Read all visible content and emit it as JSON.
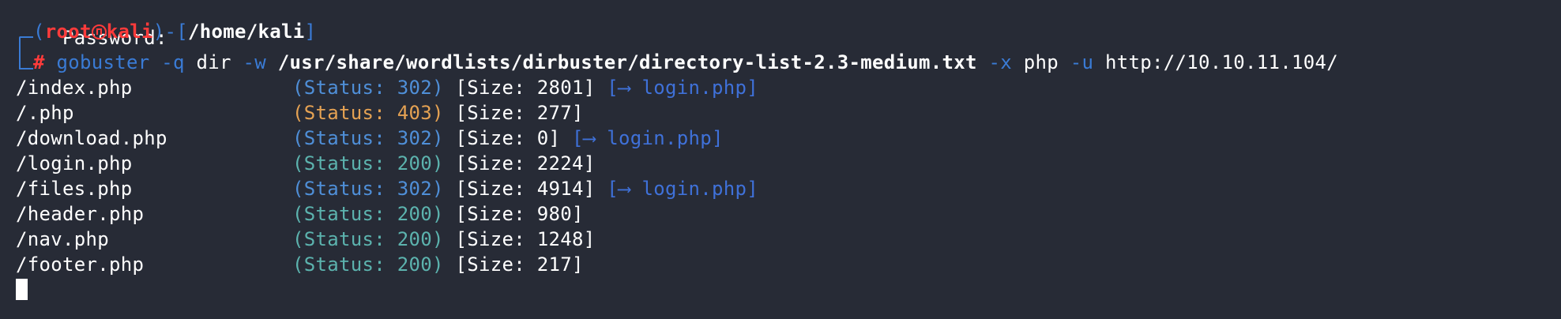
{
  "terminal": {
    "password_prompt": "Password:",
    "prompt": {
      "open_paren": "(",
      "user": "root",
      "host": "kali",
      "close_paren": ")",
      "dash": "-",
      "cwd_open": "[",
      "cwd": "/home/kali",
      "cwd_close": "]",
      "hash": "#"
    },
    "command": {
      "program": "gobuster",
      "flag_q": "-q",
      "mode": "dir",
      "flag_w": "-w",
      "wordlist": "/usr/share/wordlists/dirbuster/directory-list-2.3-medium.txt",
      "flag_x": "-x",
      "ext": "php",
      "flag_u": "-u",
      "url": "http://10.10.11.104/"
    },
    "results": [
      {
        "path": "/index.php",
        "status_text": "(Status: 302)",
        "status_code": 302,
        "size_text": "[Size: 2801]",
        "redirect": "[⟶ login.php]"
      },
      {
        "path": "/.php",
        "status_text": "(Status: 403)",
        "status_code": 403,
        "size_text": "[Size: 277]",
        "redirect": ""
      },
      {
        "path": "/download.php",
        "status_text": "(Status: 302)",
        "status_code": 302,
        "size_text": "[Size: 0]",
        "redirect": "[⟶ login.php]"
      },
      {
        "path": "/login.php",
        "status_text": "(Status: 200)",
        "status_code": 200,
        "size_text": "[Size: 2224]",
        "redirect": ""
      },
      {
        "path": "/files.php",
        "status_text": "(Status: 302)",
        "status_code": 302,
        "size_text": "[Size: 4914]",
        "redirect": "[⟶ login.php]"
      },
      {
        "path": "/header.php",
        "status_text": "(Status: 200)",
        "status_code": 200,
        "size_text": "[Size: 980]",
        "redirect": ""
      },
      {
        "path": "/nav.php",
        "status_text": "(Status: 200)",
        "status_code": 200,
        "size_text": "[Size: 1248]",
        "redirect": ""
      },
      {
        "path": "/footer.php",
        "status_text": "(Status: 200)",
        "status_code": 200,
        "size_text": "[Size: 217]",
        "redirect": ""
      }
    ],
    "colors": {
      "background": "#272b36",
      "prompt_blue": "#3a7bd5",
      "prompt_red": "#ff3b3b",
      "status_302": "#4f8fd8",
      "status_403": "#e5a253",
      "status_200": "#5cb3ae",
      "redirect": "#3f71d9"
    }
  }
}
